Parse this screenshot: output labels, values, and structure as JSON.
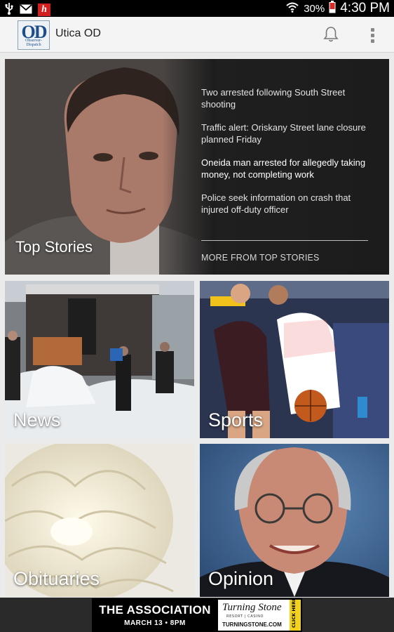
{
  "status_bar": {
    "battery_percent": "30%",
    "time": "4:30 PM",
    "icons": [
      "usb-icon",
      "mail-icon",
      "h-app-icon",
      "wifi-icon",
      "battery-icon"
    ]
  },
  "app_bar": {
    "logo_text": "OD",
    "logo_subtext": "Observer-Dispatch",
    "title": "Utica OD",
    "icons": [
      "bell-icon",
      "overflow-menu-icon"
    ]
  },
  "top_stories": {
    "label": "Top Stories",
    "items": [
      {
        "headline": "Two arrested following South Street shooting"
      },
      {
        "headline": "Traffic alert: Oriskany Street lane closure planned Friday"
      },
      {
        "headline": "Oneida man arrested for allegedly taking money, not completing work"
      },
      {
        "headline": "Police seek information on crash that injured off-duty officer"
      }
    ],
    "more_link": "MORE FROM TOP STORIES"
  },
  "sections": [
    {
      "label": "News"
    },
    {
      "label": "Sports"
    },
    {
      "label": "Obituaries"
    },
    {
      "label": "Opinion"
    }
  ],
  "ad": {
    "headline": "THE ASSOCIATION",
    "date": "MARCH 13 • 8PM",
    "brand": "Turning Stone",
    "brand_tagline": "RESORT | CASINO",
    "url": "TURNINGSTONE.COM",
    "cta": "CLICK HERE"
  },
  "colors": {
    "status_bar": "#000000",
    "app_bar": "#f4f4f4",
    "page_bg": "#ebebeb",
    "card_dark": "#1c1c1c",
    "logo_blue": "#1b4e8a",
    "ad_cta_yellow": "#f2d21b"
  }
}
